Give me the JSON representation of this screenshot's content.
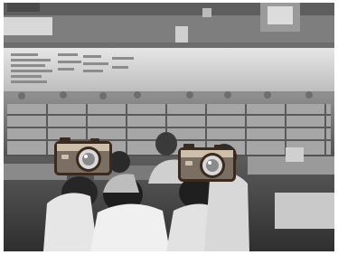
{
  "photo": {
    "style": "grayscale",
    "subject": "classroom-with-students-at-desks",
    "overlays": [
      {
        "icon": "camera-icon",
        "colors": {
          "body": "#7b6e62",
          "outline": "#3b2a1e",
          "top": "#cdbfa9",
          "lens": "#d9d9d9"
        }
      },
      {
        "icon": "camera-icon",
        "colors": {
          "body": "#7b6e62",
          "outline": "#3b2a1e",
          "top": "#cdbfa9",
          "lens": "#d9d9d9"
        }
      }
    ]
  }
}
